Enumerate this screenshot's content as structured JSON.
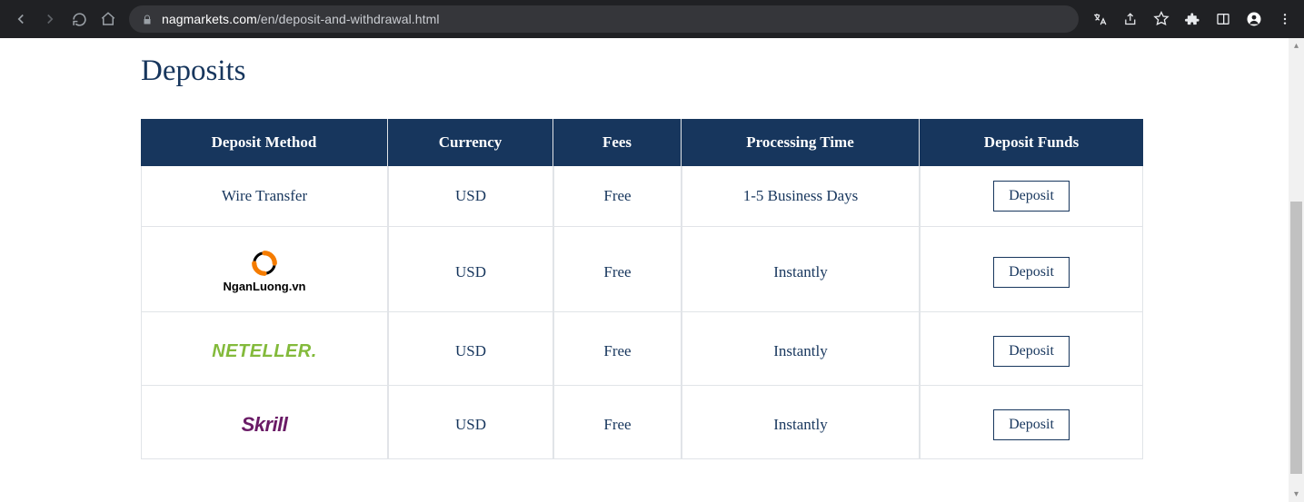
{
  "browser": {
    "url_domain": "nagmarkets.com",
    "url_path": "/en/deposit-and-withdrawal.html"
  },
  "page": {
    "title": "Deposits",
    "headers": {
      "method": "Deposit Method",
      "currency": "Currency",
      "fees": "Fees",
      "time": "Processing Time",
      "funds": "Deposit Funds"
    },
    "rows": [
      {
        "method_text": "Wire Transfer",
        "method_logo": "none",
        "currency": "USD",
        "fees": "Free",
        "time": "1-5 Business Days",
        "action": "Deposit"
      },
      {
        "method_text": "NganLuong.vn",
        "method_logo": "nganluong",
        "currency": "USD",
        "fees": "Free",
        "time": "Instantly",
        "action": "Deposit"
      },
      {
        "method_text": "NETELLER.",
        "method_logo": "neteller",
        "currency": "USD",
        "fees": "Free",
        "time": "Instantly",
        "action": "Deposit"
      },
      {
        "method_text": "Skrill",
        "method_logo": "skrill",
        "currency": "USD",
        "fees": "Free",
        "time": "Instantly",
        "action": "Deposit"
      }
    ]
  }
}
